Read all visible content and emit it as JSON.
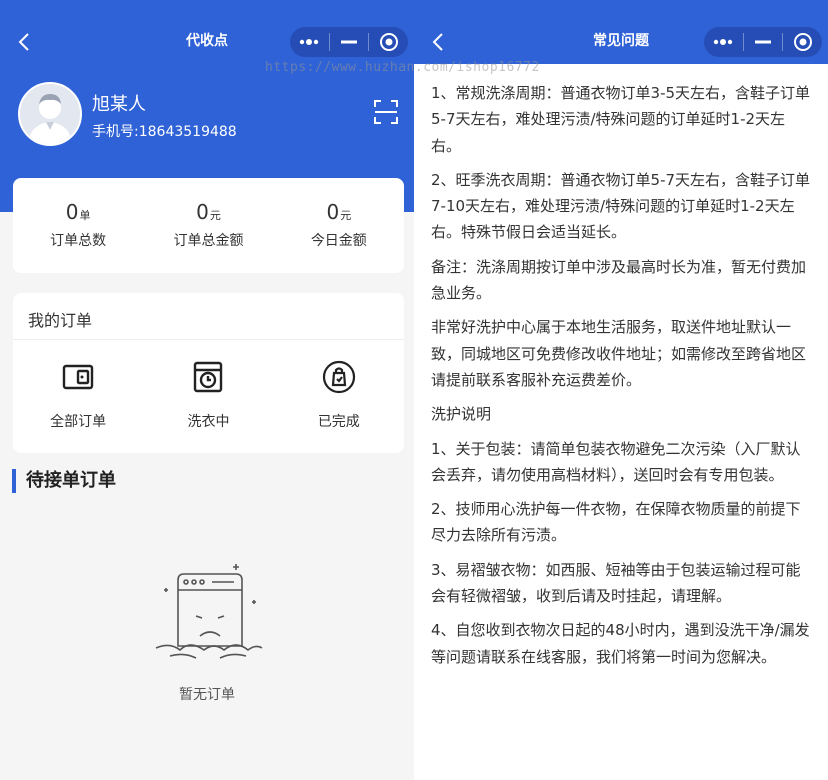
{
  "left": {
    "nav": {
      "title": "代收点"
    },
    "profile": {
      "name": "旭某人",
      "phone": "手机号:18643519488"
    },
    "stats": [
      {
        "value": "0",
        "unit": "单",
        "label": "订单总数"
      },
      {
        "value": "0",
        "unit": "元",
        "label": "订单总金额"
      },
      {
        "value": "0",
        "unit": "元",
        "label": "今日金额"
      }
    ],
    "orders": {
      "title": "我的订单",
      "items": [
        {
          "label": "全部订单",
          "icon": "wallet-icon"
        },
        {
          "label": "洗衣中",
          "icon": "washing-machine-icon"
        },
        {
          "label": "已完成",
          "icon": "laundry-bag-icon"
        }
      ]
    },
    "pending": {
      "title": "待接单订单",
      "empty_text": "暂无订单"
    }
  },
  "right": {
    "nav": {
      "title": "常见问题"
    },
    "watermark": "https://www.huzhan.com/ishop16772",
    "paragraphs": [
      "1、常规洗涤周期：普通衣物订单3-5天左右，含鞋子订单5-7天左右，难处理污渍/特殊问题的订单延时1-2天左右。",
      "2、旺季洗衣周期：普通衣物订单5-7天左右，含鞋子订单7-10天左右，难处理污渍/特殊问题的订单延时1-2天左右。特殊节假日会适当延长。",
      "备注：洗涤周期按订单中涉及最高时长为准，暂无付费加急业务。",
      "非常好洗护中心属于本地生活服务，取送件地址默认一致，同城地区可免费修改收件地址；如需修改至跨省地区请提前联系客服补充运费差价。",
      "洗护说明",
      "1、关于包装：请简单包装衣物避免二次污染（入厂默认会丢弃，请勿使用高档材料），送回时会有专用包装。",
      "2、技师用心洗护每一件衣物，在保障衣物质量的前提下尽力去除所有污渍。",
      "3、易褶皱衣物：如西服、短袖等由于包装运输过程可能会有轻微褶皱，收到后请及时挂起，请理解。",
      "4、自您收到衣物次日起的48小时内，遇到没洗干净/漏发等问题请联系在线客服，我们将第一时间为您解决。"
    ]
  },
  "colors": {
    "brand_blue": "#2f62d6",
    "page_bg": "#f5f5f5",
    "card_bg": "#ffffff"
  }
}
